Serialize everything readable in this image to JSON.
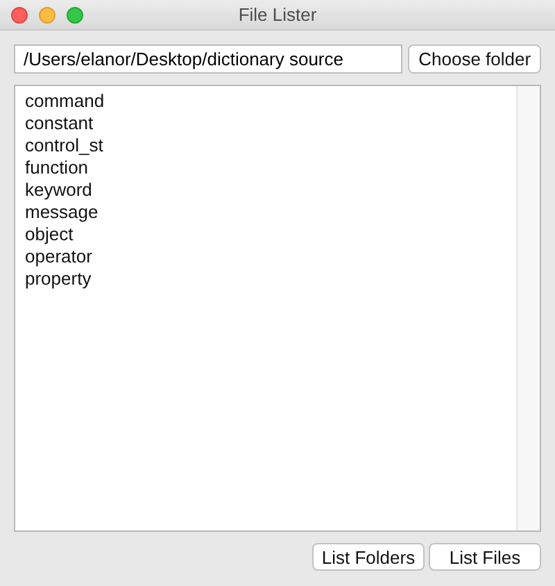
{
  "window": {
    "title": "File Lister"
  },
  "path_field": {
    "value": "/Users/elanor/Desktop/dictionary source"
  },
  "choose_button": {
    "label": "Choose folder"
  },
  "list": {
    "items": [
      {
        "label": "command"
      },
      {
        "label": "constant"
      },
      {
        "label": "control_st"
      },
      {
        "label": "function"
      },
      {
        "label": "keyword"
      },
      {
        "label": "message"
      },
      {
        "label": "object"
      },
      {
        "label": "operator"
      },
      {
        "label": "property"
      }
    ]
  },
  "buttons": [
    {
      "label": "List Folders"
    },
    {
      "label": "List Files"
    }
  ]
}
